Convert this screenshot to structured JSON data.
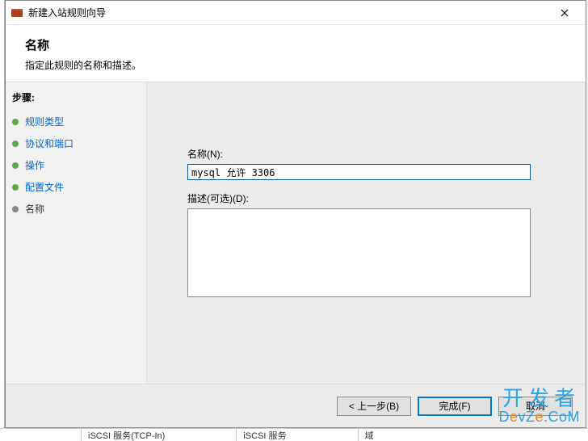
{
  "window": {
    "title": "新建入站规则向导"
  },
  "header": {
    "title": "名称",
    "description": "指定此规则的名称和描述。"
  },
  "sidebar": {
    "heading": "步骤:",
    "steps": [
      {
        "label": "规则类型",
        "current": false
      },
      {
        "label": "协议和端口",
        "current": false
      },
      {
        "label": "操作",
        "current": false
      },
      {
        "label": "配置文件",
        "current": false
      },
      {
        "label": "名称",
        "current": true
      }
    ]
  },
  "form": {
    "name_label": "名称(N):",
    "name_value": "mysql 允许 3306",
    "desc_label": "描述(可选)(D):",
    "desc_value": ""
  },
  "footer": {
    "back": "< 上一步(B)",
    "finish": "完成(F)",
    "cancel": "取消"
  },
  "background": {
    "row1": "iSCSI 服务(TCP-In)",
    "row2": "iSCSI 服务",
    "row3": "域"
  },
  "watermark": {
    "cn": "开发者",
    "en_pre": "D",
    "en_alt": "e",
    "en_mid": "vZ",
    "en_alt2": "e",
    "en_post": ".CoM"
  }
}
